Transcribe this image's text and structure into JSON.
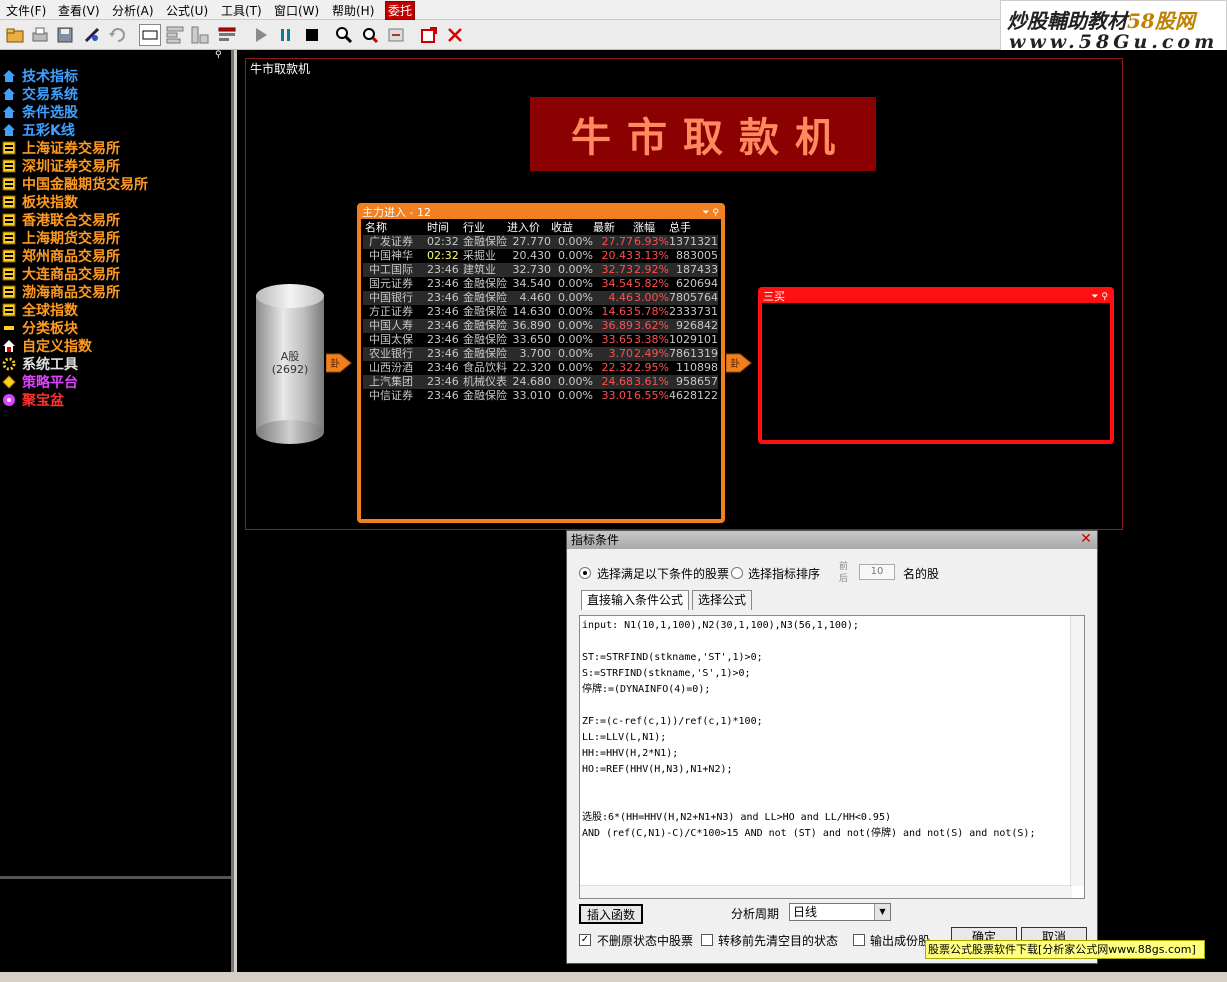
{
  "menubar": {
    "items": [
      "文件(F)",
      "查看(V)",
      "分析(A)",
      "公式(U)",
      "工具(T)",
      "窗口(W)",
      "帮助(H)",
      "委托"
    ]
  },
  "watermark": {
    "line1_a": "炒股輔助教材",
    "line1_b": "58股网",
    "line2": "www.58Gu.com"
  },
  "toolbar": {
    "icons": [
      "open-folder-icon",
      "print-icon",
      "save-icon",
      "connect-icon",
      "undo-icon",
      "window-icon",
      "layout-icon",
      "layout2-icon",
      "layout3-icon",
      "play-icon",
      "pause-icon",
      "stop-icon",
      "find-icon",
      "find-stock-icon",
      "export-icon",
      "new-window-icon",
      "close-icon"
    ]
  },
  "sidebar": {
    "items": [
      {
        "label": "技术指标",
        "color": "#40a0ff",
        "icon": "house"
      },
      {
        "label": "交易系统",
        "color": "#40a0ff",
        "icon": "house"
      },
      {
        "label": "条件选股",
        "color": "#40a0ff",
        "icon": "house"
      },
      {
        "label": "五彩K线",
        "color": "#40a0ff",
        "icon": "house"
      },
      {
        "label": "上海证券交易所",
        "color": "#ff9a20",
        "icon": "list"
      },
      {
        "label": "深圳证券交易所",
        "color": "#ff9a20",
        "icon": "list"
      },
      {
        "label": "中国金融期货交易所",
        "color": "#ff9a20",
        "icon": "list"
      },
      {
        "label": "板块指数",
        "color": "#ff9a20",
        "icon": "list"
      },
      {
        "label": "香港联合交易所",
        "color": "#ff9a20",
        "icon": "list"
      },
      {
        "label": "上海期货交易所",
        "color": "#ff9a20",
        "icon": "list"
      },
      {
        "label": "郑州商品交易所",
        "color": "#ff9a20",
        "icon": "list"
      },
      {
        "label": "大连商品交易所",
        "color": "#ff9a20",
        "icon": "list"
      },
      {
        "label": "渤海商品交易所",
        "color": "#ff9a20",
        "icon": "list"
      },
      {
        "label": "全球指数",
        "color": "#ff9a20",
        "icon": "list"
      },
      {
        "label": "分类板块",
        "color": "#ff9a20",
        "icon": "dash"
      },
      {
        "label": "自定义指数",
        "color": "#ff9a20",
        "icon": "house-red"
      },
      {
        "label": "系统工具",
        "color": "#e0e0e0",
        "icon": "gear"
      },
      {
        "label": "策略平台",
        "color": "#e040ff",
        "icon": "diamond"
      },
      {
        "label": "聚宝盆",
        "color": "#ff3030",
        "icon": "flower"
      }
    ]
  },
  "panel": {
    "title": "牛市取款机",
    "banner": "牛市取款机",
    "cylinder_label": "A股",
    "cylinder_count": "(2692)",
    "arrow_glyph": "卦"
  },
  "zhuli": {
    "title": "主力进入 - 12",
    "columns": [
      "名称",
      "时间",
      "行业",
      "进入价",
      "收益",
      "最新",
      "涨幅",
      "总手"
    ],
    "rows": [
      {
        "name": "广发证券",
        "time": "02:32",
        "ind": "金融保险",
        "price": "27.770",
        "ret": "0.00%",
        "last": "27.77",
        "chg": "6.93%",
        "vol": "1371321",
        "ty": false
      },
      {
        "name": "中国神华",
        "time": "02:32",
        "ind": "采掘业",
        "price": "20.430",
        "ret": "0.00%",
        "last": "20.43",
        "chg": "3.13%",
        "vol": "883005",
        "ty": true
      },
      {
        "name": "中工国际",
        "time": "23:46",
        "ind": "建筑业",
        "price": "32.730",
        "ret": "0.00%",
        "last": "32.73",
        "chg": "2.92%",
        "vol": "187433",
        "ty": false
      },
      {
        "name": "国元证券",
        "time": "23:46",
        "ind": "金融保险",
        "price": "34.540",
        "ret": "0.00%",
        "last": "34.54",
        "chg": "5.82%",
        "vol": "620694",
        "ty": false
      },
      {
        "name": "中国银行",
        "time": "23:46",
        "ind": "金融保险",
        "price": "4.460",
        "ret": "0.00%",
        "last": "4.46",
        "chg": "3.00%",
        "vol": "7805764",
        "ty": false
      },
      {
        "name": "方正证券",
        "time": "23:46",
        "ind": "金融保险",
        "price": "14.630",
        "ret": "0.00%",
        "last": "14.63",
        "chg": "5.78%",
        "vol": "2333731",
        "ty": false
      },
      {
        "name": "中国人寿",
        "time": "23:46",
        "ind": "金融保险",
        "price": "36.890",
        "ret": "0.00%",
        "last": "36.89",
        "chg": "3.62%",
        "vol": "926842",
        "ty": false
      },
      {
        "name": "中国太保",
        "time": "23:46",
        "ind": "金融保险",
        "price": "33.650",
        "ret": "0.00%",
        "last": "33.65",
        "chg": "3.38%",
        "vol": "1029101",
        "ty": false
      },
      {
        "name": "农业银行",
        "time": "23:46",
        "ind": "金融保险",
        "price": "3.700",
        "ret": "0.00%",
        "last": "3.70",
        "chg": "2.49%",
        "vol": "7861319",
        "ty": false
      },
      {
        "name": "山西汾酒",
        "time": "23:46",
        "ind": "食品饮料",
        "price": "22.320",
        "ret": "0.00%",
        "last": "22.32",
        "chg": "2.95%",
        "vol": "110898",
        "ty": false
      },
      {
        "name": "上汽集团",
        "time": "23:46",
        "ind": "机械仪表",
        "price": "24.680",
        "ret": "0.00%",
        "last": "24.68",
        "chg": "3.61%",
        "vol": "958657",
        "ty": false
      },
      {
        "name": "中信证券",
        "time": "23:46",
        "ind": "金融保险",
        "price": "33.010",
        "ret": "0.00%",
        "last": "33.01",
        "chg": "6.55%",
        "vol": "4628122",
        "ty": false
      }
    ]
  },
  "sanmai": {
    "title": "三买"
  },
  "dialog": {
    "title": "指标条件",
    "radio_condition": "选择满足以下条件的股票",
    "radio_rank": "选择指标排序",
    "rank_front": "前",
    "rank_back": "后",
    "rank_n": "10",
    "rank_suffix": "名的股",
    "tab_direct": "直接输入条件公式",
    "tab_select": "选择公式",
    "formula": "input: N1(10,1,100),N2(30,1,100),N3(56,1,100);\n\nST:=STRFIND(stkname,'ST',1)>0;\nS:=STRFIND(stkname,'S',1)>0;\n停牌:=(DYNAINFO(4)=0);\n\nZF:=(c-ref(c,1))/ref(c,1)*100;\nLL:=LLV(L,N1);\nHH:=HHV(H,2*N1);\nHO:=REF(HHV(H,N3),N1+N2);\n\n\n选股:6*(HH=HHV(H,N2+N1+N3) and LL>HO and LL/HH<0.95)\nAND (ref(C,N1)-C)/C*100>15 AND not (ST) and not(停牌) and not(S) and not(S);",
    "insert_button": "插入函数",
    "period_label": "分析周期",
    "period_value": "日线",
    "chk_keep": "不删原状态中股票",
    "chk_clear": "转移前先清空目的状态",
    "chk_output": "输出成份股",
    "ok_button": "确定",
    "cancel_button": "取消"
  },
  "ad_text": "股票公式股票软件下载[分析家公式网www.88gs.com]"
}
